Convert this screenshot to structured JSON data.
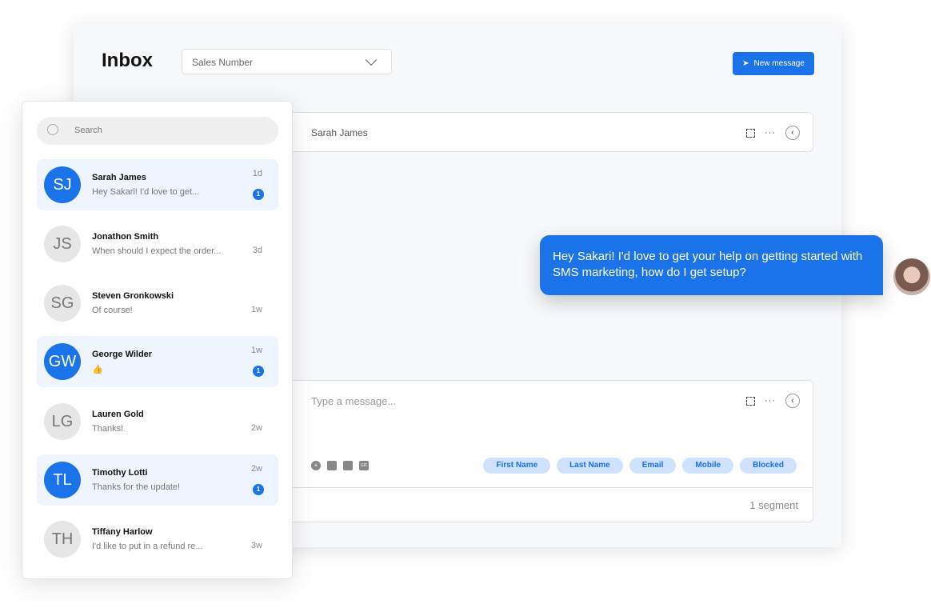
{
  "header": {
    "title": "Inbox",
    "select_value": "Sales Number",
    "new_message": "New message"
  },
  "conversation": {
    "contact": "Sarah James",
    "contact_initials": "SJ"
  },
  "message": {
    "text": "Hey Sakari! I'd love to get your help on getting started with SMS marketing, how do I get setup?"
  },
  "composer": {
    "placeholder": "Type a message...",
    "chips": [
      "First Name",
      "Last Name",
      "Email",
      "Mobile",
      "Blocked"
    ],
    "segments": "1 segment",
    "gif": "GIF"
  },
  "list": {
    "search_placeholder": "Search",
    "items": [
      {
        "initials": "SJ",
        "name": "Sarah James",
        "preview": "Hey Sakari! I'd love to get...",
        "time": "1d",
        "unread": "1"
      },
      {
        "initials": "JS",
        "name": "Jonathon Smith",
        "preview": "When should I expect the order...",
        "time": "3d"
      },
      {
        "initials": "SG",
        "name": "Steven Gronkowski",
        "preview": "Of course!",
        "time": "1w"
      },
      {
        "initials": "GW",
        "name": "George Wilder",
        "preview": "👍",
        "time": "1w",
        "unread": "1"
      },
      {
        "initials": "LG",
        "name": "Lauren Gold",
        "preview": "Thanks!",
        "time": "2w"
      },
      {
        "initials": "TL",
        "name": "Timothy Lotti",
        "preview": "Thanks for the update!",
        "time": "2w",
        "unread": "1"
      },
      {
        "initials": "TH",
        "name": "Tiffany Harlow",
        "preview": "I'd like to put in a refund re...",
        "time": "3w"
      }
    ]
  },
  "colors": {
    "accent": "#1a73e8",
    "chip_bg": "#cfe3ff"
  }
}
